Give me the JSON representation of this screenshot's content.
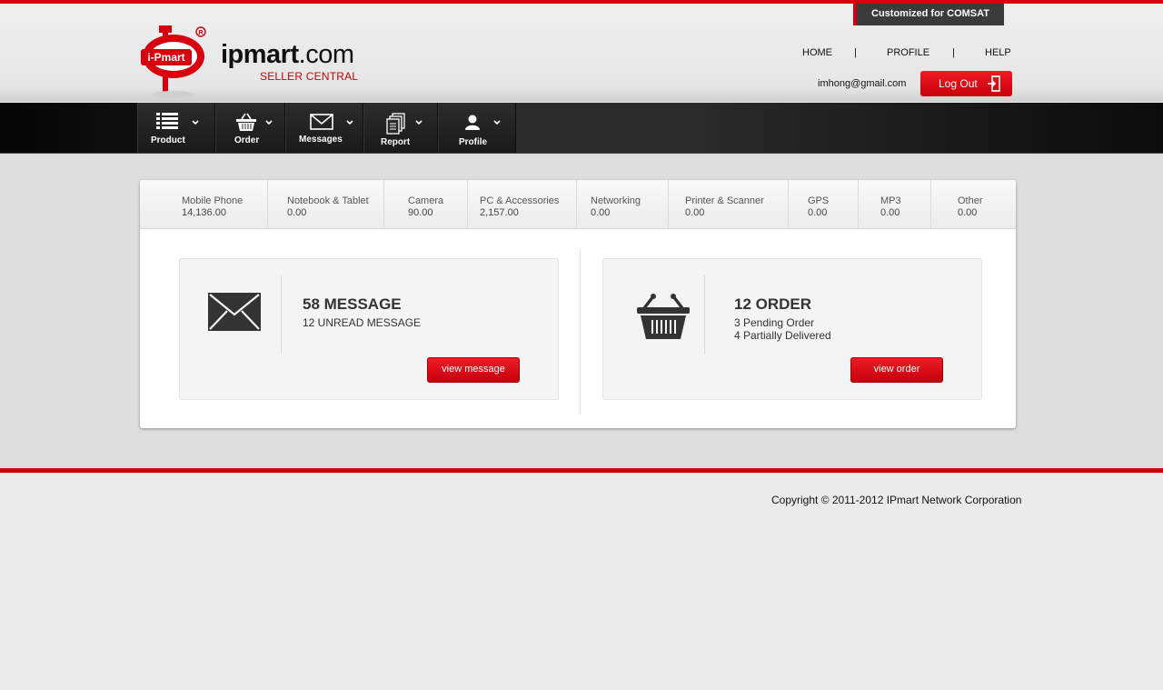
{
  "header": {
    "badge": "Customized for COMSAT",
    "logo_main": "ipmart",
    "logo_tld": ".com",
    "logo_sub": "SELLER CENTRAL",
    "logo_emblem_text": "i-Pmart",
    "links": {
      "home": "HOME",
      "profile": "PROFILE",
      "help": "HELP",
      "separator": "|"
    },
    "user_email": "imhong@gmail.com",
    "logout_label": "Log Out"
  },
  "navbar": {
    "items": [
      {
        "label": "Product",
        "icon": "list-icon"
      },
      {
        "label": "Order",
        "icon": "basket-icon"
      },
      {
        "label": "Messages",
        "icon": "envelope-icon"
      },
      {
        "label": "Report",
        "icon": "documents-icon"
      },
      {
        "label": "Profile",
        "icon": "user-icon"
      }
    ]
  },
  "categories": [
    {
      "name": "Mobile Phone",
      "value": "14,136.00"
    },
    {
      "name": "Notebook & Tablet",
      "value": "0.00"
    },
    {
      "name": "Camera",
      "value": "90.00"
    },
    {
      "name": "PC & Accessories",
      "value": "2,157.00"
    },
    {
      "name": "Networking",
      "value": "0.00"
    },
    {
      "name": "Printer & Scanner",
      "value": "0.00"
    },
    {
      "name": "GPS",
      "value": "0.00"
    },
    {
      "name": "MP3",
      "value": "0.00"
    },
    {
      "name": "Other",
      "value": "0.00"
    }
  ],
  "messages_box": {
    "title": "58 MESSAGE",
    "line1": "12 UNREAD MESSAGE",
    "button": "view message"
  },
  "orders_box": {
    "title": "12 ORDER",
    "line1": "3 Pending Order",
    "line2": "4 Partially Delivered",
    "button": "view order"
  },
  "footer": {
    "copyright": "Copyright © 2011-2012 IPmart Network Corporation"
  },
  "colors": {
    "brand_red": "#d6000f",
    "nav_dark": "#1a1a1a",
    "page_bg": "#ebebeb"
  }
}
